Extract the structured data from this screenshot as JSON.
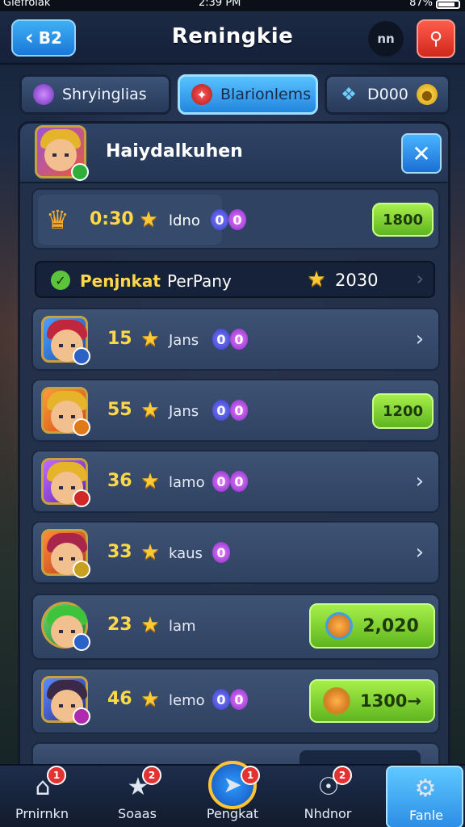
{
  "status": {
    "carrier": "Glefrolak",
    "time": "2:39 PM",
    "battery": "87%"
  },
  "header": {
    "back_label": "B2",
    "title": "Reningkie",
    "icon_dark_label": "nn"
  },
  "tabs": [
    {
      "label": "Shryinglias",
      "icon": "orb-icon"
    },
    {
      "label": "Blarionlems",
      "icon": "ruby-icon"
    },
    {
      "label": "D000",
      "icon": "crystal-icon"
    }
  ],
  "panel": {
    "player_name": "Haiydalkuhen",
    "summary": {
      "time": "0:30",
      "label": "ldno",
      "gem_text": "0",
      "button": "1800"
    },
    "progress": {
      "label_a": "Penjnkat",
      "label_b": "PerPany",
      "value": "2030"
    },
    "rows": [
      {
        "rank": "15",
        "label": "Jans",
        "gem_text": "0",
        "action": "chevron",
        "button": ""
      },
      {
        "rank": "55",
        "label": "Jans",
        "gem_text": "0",
        "action": "button",
        "button": "1200"
      },
      {
        "rank": "36",
        "label": "lamo",
        "gem_text": "0",
        "action": "chevron",
        "button": ""
      },
      {
        "rank": "33",
        "label": "kaus",
        "gem_text": "0",
        "action": "chevron",
        "button": ""
      },
      {
        "rank": "23",
        "label": "lam",
        "gem_text": "",
        "action": "coinbutton",
        "button": "2,020"
      },
      {
        "rank": "46",
        "label": "lemo",
        "gem_text": "0",
        "action": "coinbutton",
        "button": "1300→"
      }
    ]
  },
  "nav": [
    {
      "label": "Prnirnkn",
      "badge": "1",
      "icon": "home-icon"
    },
    {
      "label": "Soaas",
      "badge": "2",
      "icon": "star-icon"
    },
    {
      "label": "Pengkat",
      "badge": "1",
      "icon": "lightning-icon"
    },
    {
      "label": "Nhdnor",
      "badge": "2",
      "icon": "compass-icon"
    },
    {
      "label": "Fanle",
      "badge": "",
      "icon": "gear-icon"
    }
  ],
  "colors": {
    "gold": "#ffd84a",
    "green_button": "#7ed33a",
    "blue_button": "#2d8ee6",
    "red_button": "#e0321f"
  }
}
